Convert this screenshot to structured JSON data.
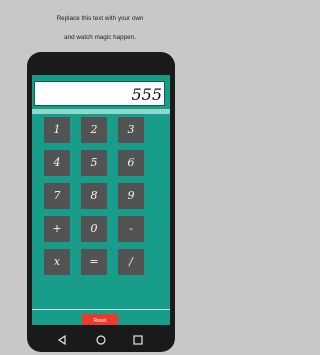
{
  "instructions": {
    "line1": "Replace this text with your own",
    "line2": "and watch magic happen."
  },
  "calculator": {
    "display": "555",
    "keys": [
      {
        "label": "1"
      },
      {
        "label": "2"
      },
      {
        "label": "3"
      },
      {
        "label": "4"
      },
      {
        "label": "5"
      },
      {
        "label": "6"
      },
      {
        "label": "7"
      },
      {
        "label": "8"
      },
      {
        "label": "9"
      },
      {
        "label": "+"
      },
      {
        "label": "0"
      },
      {
        "label": "-"
      },
      {
        "label": "x"
      },
      {
        "label": "="
      },
      {
        "label": "/"
      }
    ],
    "reset_label": "Reset"
  },
  "colors": {
    "background": "#c8c8c8",
    "phone": "#1a1a1a",
    "screen": "#179d8a",
    "key": "#535353",
    "reset": "#ea3c2d"
  }
}
